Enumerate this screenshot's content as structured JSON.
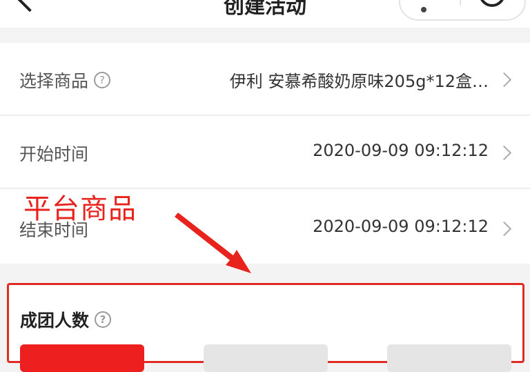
{
  "header": {
    "title": "创建活动"
  },
  "rows": [
    {
      "label": "选择商品",
      "has_help": true,
      "value": "伊利 安慕希酸奶原味205g*12盒…"
    },
    {
      "label": "开始时间",
      "has_help": false,
      "value": "2020-09-09 09:12:12"
    },
    {
      "label": "结束时间",
      "has_help": false,
      "value": "2020-09-09 09:12:12"
    }
  ],
  "annotation": {
    "text": "平台商品",
    "color": "#e8221c"
  },
  "group": {
    "title": "成团人数",
    "options": [
      {
        "label": "",
        "active": true
      },
      {
        "label": "",
        "active": false
      },
      {
        "label": "",
        "active": false
      }
    ],
    "accent": "#ee1f1f"
  },
  "icons": [
    "back-arrow-icon",
    "more-dots-icon",
    "close-circle-icon",
    "help-icon",
    "chevron-right-icon"
  ]
}
